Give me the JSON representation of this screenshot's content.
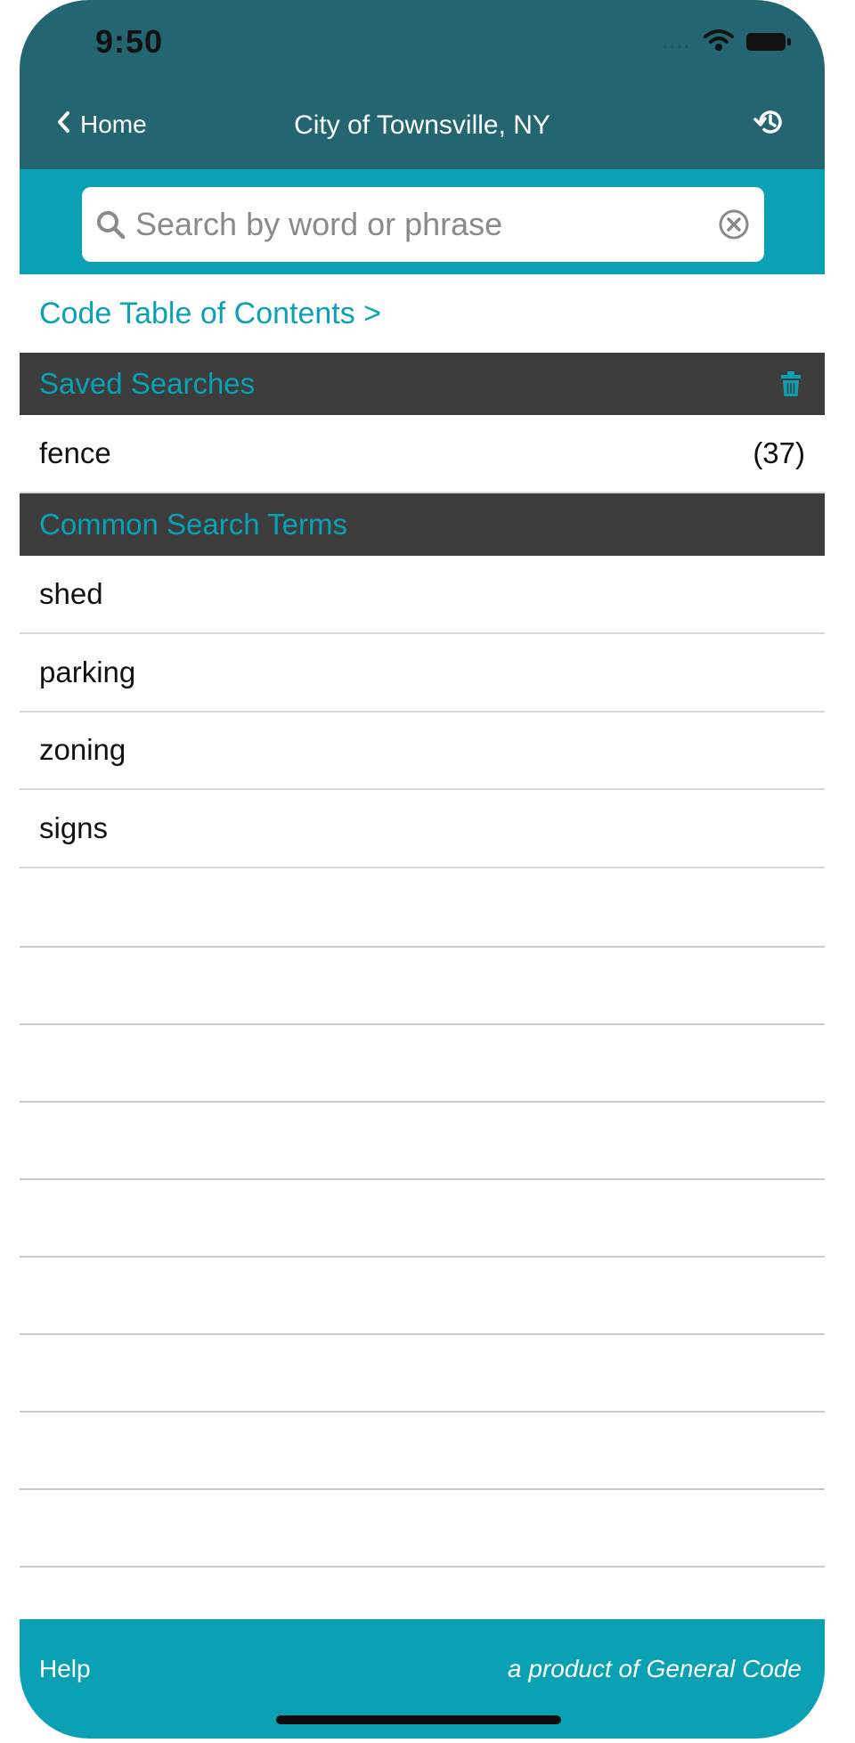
{
  "status_bar": {
    "time": "9:50",
    "signal_dots": "....",
    "wifi_icon": "wifi-icon",
    "battery_icon": "battery-icon"
  },
  "nav": {
    "back_label": "Home",
    "title": "City of Townsville, NY",
    "history_icon": "history-icon"
  },
  "search": {
    "placeholder": "Search by word or phrase",
    "value": ""
  },
  "toc_link": "Code Table of Contents >",
  "saved_searches": {
    "header": "Saved Searches",
    "items": [
      {
        "term": "fence",
        "count": "(37)"
      }
    ]
  },
  "common_terms": {
    "header": "Common Search Terms",
    "items": [
      "shed",
      "parking",
      "zoning",
      "signs"
    ]
  },
  "footer": {
    "help_label": "Help",
    "product_text": "a product of General Code"
  },
  "colors": {
    "header_dark": "#236570",
    "accent": "#0aa1b5",
    "section_bg": "#3c3c3c"
  }
}
